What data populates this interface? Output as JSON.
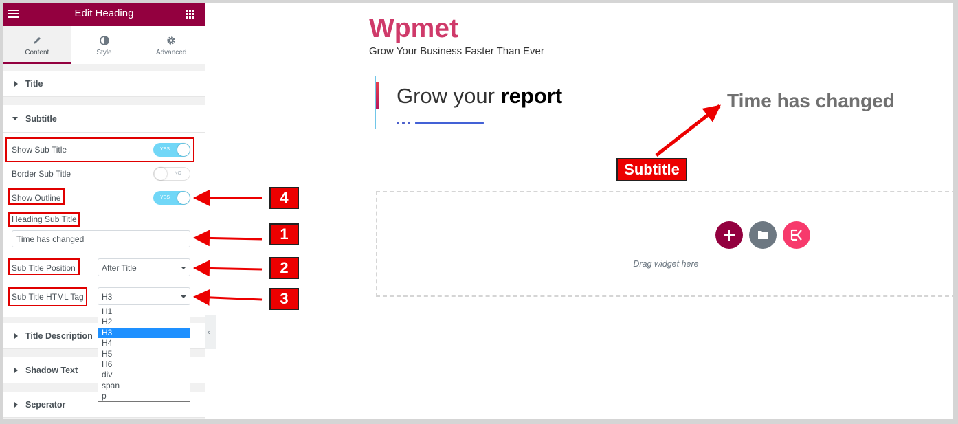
{
  "editor": {
    "panel_title": "Edit Heading",
    "tabs": [
      {
        "label": "Content",
        "icon": "pencil-icon",
        "active": true
      },
      {
        "label": "Style",
        "icon": "contrast-icon",
        "active": false
      },
      {
        "label": "Advanced",
        "icon": "gear-icon",
        "active": false
      }
    ],
    "sections": {
      "title": "Title",
      "subtitle": "Subtitle",
      "title_description": "Title Description",
      "shadow_text": "Shadow Text",
      "separator": "Seperator"
    },
    "controls": {
      "show_sub_title": {
        "label": "Show Sub Title",
        "state": "YES"
      },
      "border_sub_title": {
        "label": "Border Sub Title",
        "state": "NO"
      },
      "show_outline": {
        "label": "Show Outline",
        "state": "YES"
      },
      "heading_sub_title": {
        "label": "Heading Sub Title",
        "value": "Time has changed"
      },
      "sub_title_position": {
        "label": "Sub Title Position",
        "value": "After Title"
      },
      "sub_title_html_tag": {
        "label": "Sub Title HTML Tag",
        "value": "H3",
        "options": [
          "H1",
          "H2",
          "H3",
          "H4",
          "H5",
          "H6",
          "div",
          "span",
          "p"
        ]
      }
    }
  },
  "canvas": {
    "brand": "Wpmet",
    "tagline": "Grow Your Business Faster Than Ever",
    "heading": {
      "normal": "Grow your ",
      "bold": "report"
    },
    "subtitle": "Time has changed",
    "drag_hint": "Drag widget here"
  },
  "annotations": {
    "subtitle_callout": "Subtitle",
    "numbers": [
      "4",
      "1",
      "2",
      "3"
    ]
  },
  "colors": {
    "brand_magenta": "#93003f",
    "brand_text": "#cf3a6a",
    "toggle_on": "#71d7f7",
    "annotation_red": "#ec0000",
    "separator_blue": "#4361d6",
    "elementskit_pink": "#f73a6c"
  }
}
